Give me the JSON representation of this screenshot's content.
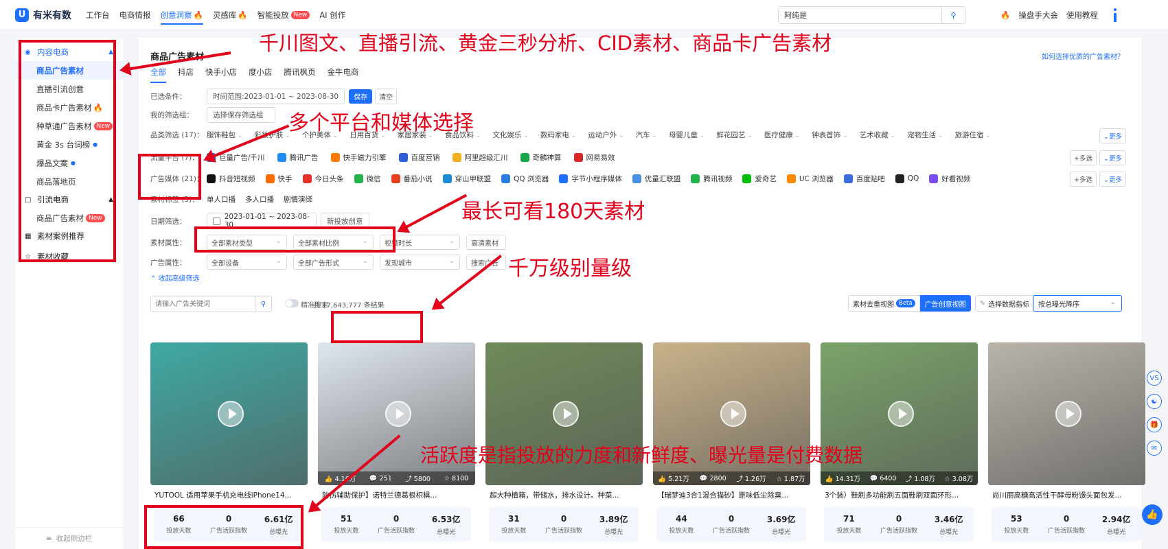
{
  "brand": {
    "name": "有米有数",
    "logo_char": "U"
  },
  "nav": [
    {
      "label": "工作台",
      "mark": ""
    },
    {
      "label": "电商情报",
      "mark": ""
    },
    {
      "label": "创意洞察",
      "mark": "fire"
    },
    {
      "label": "灵感库",
      "mark": "fire"
    },
    {
      "label": "智能投放",
      "mark": "new"
    },
    {
      "label": "AI 创作",
      "mark": ""
    }
  ],
  "nav_new_badge": "New",
  "top_search": {
    "value": "阿纯是"
  },
  "top_right": {
    "trader_link": "操盘手大会",
    "tutorial_link": "使用教程"
  },
  "sidebar": {
    "group_content": "内容电商",
    "content_items": [
      {
        "label": "商品广告素材",
        "mark": ""
      },
      {
        "label": "直播引流创意",
        "mark": ""
      },
      {
        "label": "商品卡广告素材",
        "mark": "fire"
      },
      {
        "label": "种草通广告素材",
        "mark": "new"
      },
      {
        "label": "黄金 3s 台词榜",
        "mark": "dot"
      },
      {
        "label": "爆品文案",
        "mark": "dot"
      },
      {
        "label": "商品落地页",
        "mark": ""
      }
    ],
    "group_traffic": "引流电商",
    "traffic_items": [
      {
        "label": "商品广告素材",
        "mark": "new"
      }
    ],
    "case_recommend": "素材案例推荐",
    "favorites": "素材收藏",
    "collapse": "收起侧边栏",
    "new_badge": "New"
  },
  "main": {
    "title": "商品广告素材",
    "help": "如何选择优质的广告素材？",
    "tabs": [
      "全部",
      "抖店",
      "快手小店",
      "度小店",
      "腾讯枫页",
      "金牛电商"
    ],
    "selected_label": "已选条件：",
    "selected_value": "时间范围:2023-01-01 ~ 2023-08-30",
    "save_label": "保存",
    "clear_label": "清空",
    "my_filters_label": "我的筛选组：",
    "my_filters_placeholder": "选择保存筛选组",
    "category_label": "品类筛选 (17)：",
    "categories": [
      "服饰鞋包",
      "彩妆护肤",
      "个护美体",
      "日用百货",
      "家居家装",
      "食品饮料",
      "文化娱乐",
      "数码家电",
      "运动户外",
      "汽车",
      "母婴儿童",
      "鲜花园艺",
      "医疗健康",
      "钟表首饰",
      "艺术收藏",
      "宠物生活",
      "旅游住宿"
    ],
    "more_label": "更多",
    "multi_label": "多选",
    "platform_label": "流量平台 (7)：",
    "platforms": [
      {
        "label": "巨量广告/千川",
        "color": "#2a62d9"
      },
      {
        "label": "腾讯广告",
        "color": "#1e8cf0"
      },
      {
        "label": "快手磁力引擎",
        "color": "#ff7a00"
      },
      {
        "label": "百度营销",
        "color": "#2b5fd9"
      },
      {
        "label": "阿里超级汇川",
        "color": "#f2b01e"
      },
      {
        "label": "奇麟神算",
        "color": "#14a74a"
      },
      {
        "label": "网易易效",
        "color": "#d8262a"
      }
    ],
    "media_label": "广告媒体 (21)：",
    "media": [
      {
        "label": "抖音短视频",
        "color": "#111111"
      },
      {
        "label": "快手",
        "color": "#ff6a00"
      },
      {
        "label": "今日头条",
        "color": "#e7302a"
      },
      {
        "label": "微信",
        "color": "#21b24b"
      },
      {
        "label": "番茄小说",
        "color": "#e8401c"
      },
      {
        "label": "穿山甲联盟",
        "color": "#1b8bd6"
      },
      {
        "label": "QQ 浏览器",
        "color": "#2a7de1"
      },
      {
        "label": "字节小程序媒体",
        "color": "#1f6fff"
      },
      {
        "label": "优量汇联盟",
        "color": "#4a90e2"
      },
      {
        "label": "腾讯视频",
        "color": "#21b24b"
      },
      {
        "label": "爱奇艺",
        "color": "#00be06"
      },
      {
        "label": "UC 浏览器",
        "color": "#ff8a00"
      },
      {
        "label": "百度贴吧",
        "color": "#3b6cd9"
      },
      {
        "label": "QQ",
        "color": "#222222"
      },
      {
        "label": "好看视频",
        "color": "#7a4df0"
      }
    ],
    "tag_label": "素材标签 (3)：",
    "tags": [
      "单人口播",
      "多人口播",
      "剧情演绎"
    ],
    "date_label": "日期筛选：",
    "date_value": "2023-01-01 ~ 2023-08-30",
    "new_creative": "新投放创意",
    "material_attr_label": "素材属性：",
    "material_selects": [
      "全部素材类型",
      "全部素材比例",
      "视频时长",
      "高清素材"
    ],
    "ad_attr_label": "广告属性：",
    "ad_selects": [
      "全部设备",
      "全部广告形式",
      "发现城市",
      "搜索广告"
    ],
    "collapse_advanced": "收起高级筛选",
    "keyword_placeholder": "请输入广告关键词",
    "precise_label": "精准搜索",
    "result_count": "共 17,643,777 条结果",
    "view_dedupe": "素材去重视图",
    "beta": "Beta",
    "view_creative": "广告创意视图",
    "metric_select": "选择数据指标",
    "sort_value": "按总曝光降序"
  },
  "cards": [
    {
      "title": "YUTOOL 适用苹果手机充电线iPhone14...",
      "stats": [],
      "days": "66",
      "active": "0",
      "exposure": "6.61亿",
      "theme": "#3fa9a3"
    },
    {
      "title": "防伤辅助保护】诺特兰德葛根枳椇...",
      "stats": [
        "4.16万",
        "251",
        "5800",
        "8100"
      ],
      "days": "51",
      "active": "0",
      "exposure": "6.53亿",
      "theme": "#dfe6ee"
    },
    {
      "title": "超大种植箱，带储水，排水设计。种菜...",
      "stats": [],
      "days": "31",
      "active": "0",
      "exposure": "3.89亿",
      "theme": "#6f8a5a"
    },
    {
      "title": "【瑞梦迪3合1混合猫砂】原味低尘除臭...",
      "stats": [
        "5.21万",
        "2800",
        "1.26万",
        "1.87万"
      ],
      "days": "44",
      "active": "0",
      "exposure": "3.69亿",
      "theme": "#c9b28a"
    },
    {
      "title": "3个装）鞋刷多功能刷五面鞋刷双面环形...",
      "stats": [
        "14.31万",
        "6400",
        "1.08万",
        "3.08万"
      ],
      "days": "71",
      "active": "0",
      "exposure": "3.46亿",
      "theme": "#7aa36a"
    },
    {
      "title": "尚川丽高糖高活性干酵母粉馒头面包发...",
      "stats": [],
      "days": "53",
      "active": "0",
      "exposure": "2.94亿",
      "theme": "#b9b4aa"
    }
  ],
  "card_labels": {
    "days": "投放天数",
    "active": "广告活跃指数",
    "exposure": "总曝光"
  },
  "annotations": {
    "a1": "千川图文、直播引流、黄金三秒分析、CID素材、商品卡广告素材",
    "a2": "多个平台和媒体选择",
    "a3": "最长可看180天素材",
    "a4": "千万级别量级",
    "a5": "活跃度是指投放的力度和新鲜度、曝光量是付费数据",
    "color": "#e2001a"
  }
}
